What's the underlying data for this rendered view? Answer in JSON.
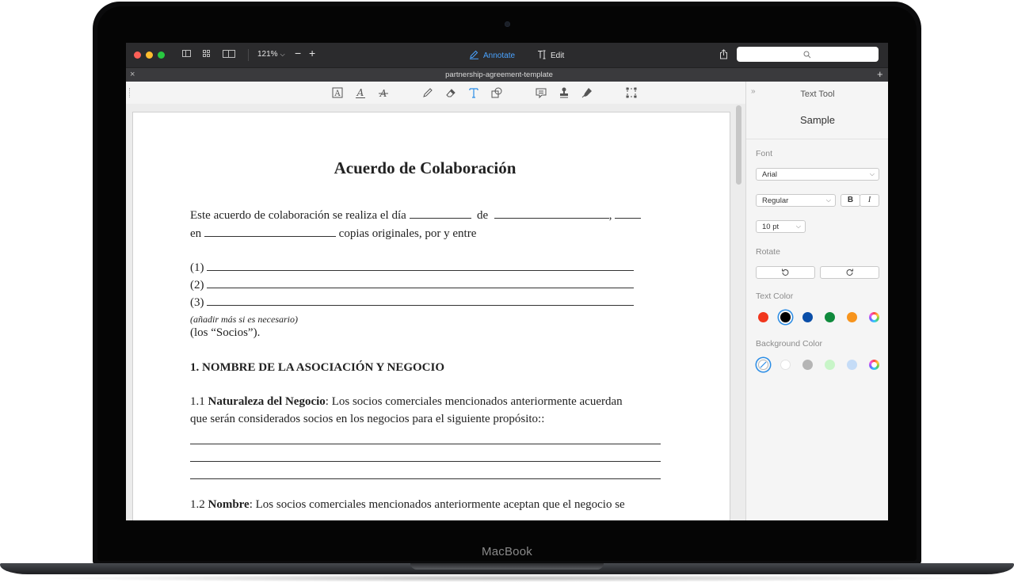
{
  "device": {
    "brand_label": "MacBook"
  },
  "toolbar": {
    "zoom_level": "121%",
    "zoom_minus": "−",
    "zoom_plus": "+",
    "annotate_label": "Annotate",
    "edit_label": "Edit",
    "search_placeholder": ""
  },
  "tab": {
    "close": "×",
    "title": "partnership-agreement-template",
    "add": "+"
  },
  "annotation_tools": [
    "text-box-icon",
    "underline-text-icon",
    "strikethrough-text-icon",
    "pencil-icon",
    "eraser-icon",
    "text-tool-icon",
    "shapes-icon",
    "note-icon",
    "stamp-icon",
    "signature-icon",
    "selection-icon"
  ],
  "document": {
    "title": "Acuerdo de Colaboración",
    "intro_1a": "Este acuerdo de colaboración se realiza el día",
    "intro_1b": "de",
    "intro_1c": ",",
    "intro_2a": "en",
    "intro_2b": "copias originales, por y entre",
    "party_1": "(1)",
    "party_2": "(2)",
    "party_3": "(3)",
    "add_more": "(añadir más si es necesario)",
    "socios": "(los “Socios”).",
    "section_1": "1. NOMBRE DE LA ASOCIACIÓN Y NEGOCIO",
    "s11_num": "1.1",
    "s11_bold": "Naturaleza del Negocio",
    "s11_text": ": Los socios comerciales mencionados anteriormente acuerdan",
    "s11_line2": "que serán considerados socios en los negocios para el siguiente propósito::",
    "s12_num": "1.2",
    "s12_bold": "Nombre",
    "s12_text": ": Los socios comerciales mencionados anteriormente aceptan que el negocio se"
  },
  "panel": {
    "toggle": "»",
    "title": "Text Tool",
    "sample": "Sample",
    "font_label": "Font",
    "font_value": "Arial",
    "style_value": "Regular",
    "bold_label": "B",
    "italic_label": "I",
    "size_value": "10 pt",
    "rotate_label": "Rotate",
    "text_color_label": "Text Color",
    "text_colors": [
      "#f1361d",
      "#000000",
      "#0a4ea8",
      "#0f8a3c",
      "#f7941d",
      "wheel"
    ],
    "text_color_selected": "#000000",
    "background_color_label": "Background Color",
    "background_colors": [
      "none",
      "#ffffff",
      "#b5b5b5",
      "#c8f5c8",
      "#c5dcf7",
      "wheel"
    ],
    "background_color_selected": "none"
  }
}
